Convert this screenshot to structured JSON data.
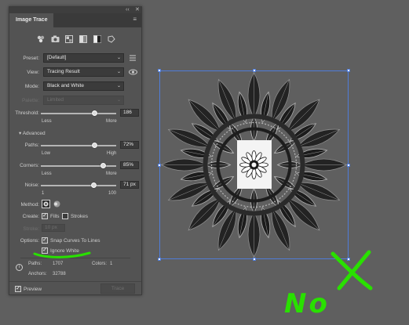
{
  "panel": {
    "title": "Image Trace",
    "window_controls": {
      "collapse": "‹‹",
      "close": "✕"
    },
    "menu_icon": "≡",
    "presets": [
      {
        "icon": "auto-color-icon"
      },
      {
        "icon": "high-color-icon"
      },
      {
        "icon": "low-color-icon"
      },
      {
        "icon": "grayscale-icon"
      },
      {
        "icon": "black-white-icon"
      },
      {
        "icon": "outline-icon"
      }
    ],
    "preset": {
      "label": "Preset:",
      "value": "[Default]"
    },
    "view": {
      "label": "View:",
      "value": "Tracing Result"
    },
    "mode": {
      "label": "Mode:",
      "value": "Black and White"
    },
    "palette": {
      "label": "Palette:",
      "value": "Limited"
    },
    "threshold": {
      "label": "Threshold:",
      "value": "186",
      "min_label": "Less",
      "max_label": "More",
      "level": 0.73
    },
    "advanced": {
      "label": "Advanced"
    },
    "paths": {
      "label": "Paths:",
      "value": "72%",
      "min_label": "Low",
      "max_label": "High",
      "level": 0.72
    },
    "corners": {
      "label": "Corners:",
      "value": "85%",
      "min_label": "Less",
      "max_label": "More",
      "level": 0.85
    },
    "noise": {
      "label": "Noise:",
      "value": "71 px",
      "min_label": "1",
      "max_label": "100",
      "level": 0.71
    },
    "method": {
      "label": "Method:"
    },
    "create": {
      "label": "Create:",
      "fills": "Fills",
      "strokes": "Strokes"
    },
    "stroke": {
      "label": "Stroke:",
      "value": "10 px"
    },
    "options": {
      "label": "Options:",
      "snap": "Snap Curves To Lines",
      "ignore_white": "Ignore White"
    },
    "info": {
      "paths_label": "Paths:",
      "paths_value": "1707",
      "colors_label": "Colors:",
      "colors_value": "1",
      "anchors_label": "Anchors:",
      "anchors_value": "32788"
    },
    "preview": "Preview",
    "trace": "Trace"
  },
  "annotations": {
    "text": "No",
    "color": "#29e000"
  },
  "colors": {
    "canvas": "#5f5f5f",
    "panel": "#535353",
    "selection": "#4f7cd9"
  }
}
